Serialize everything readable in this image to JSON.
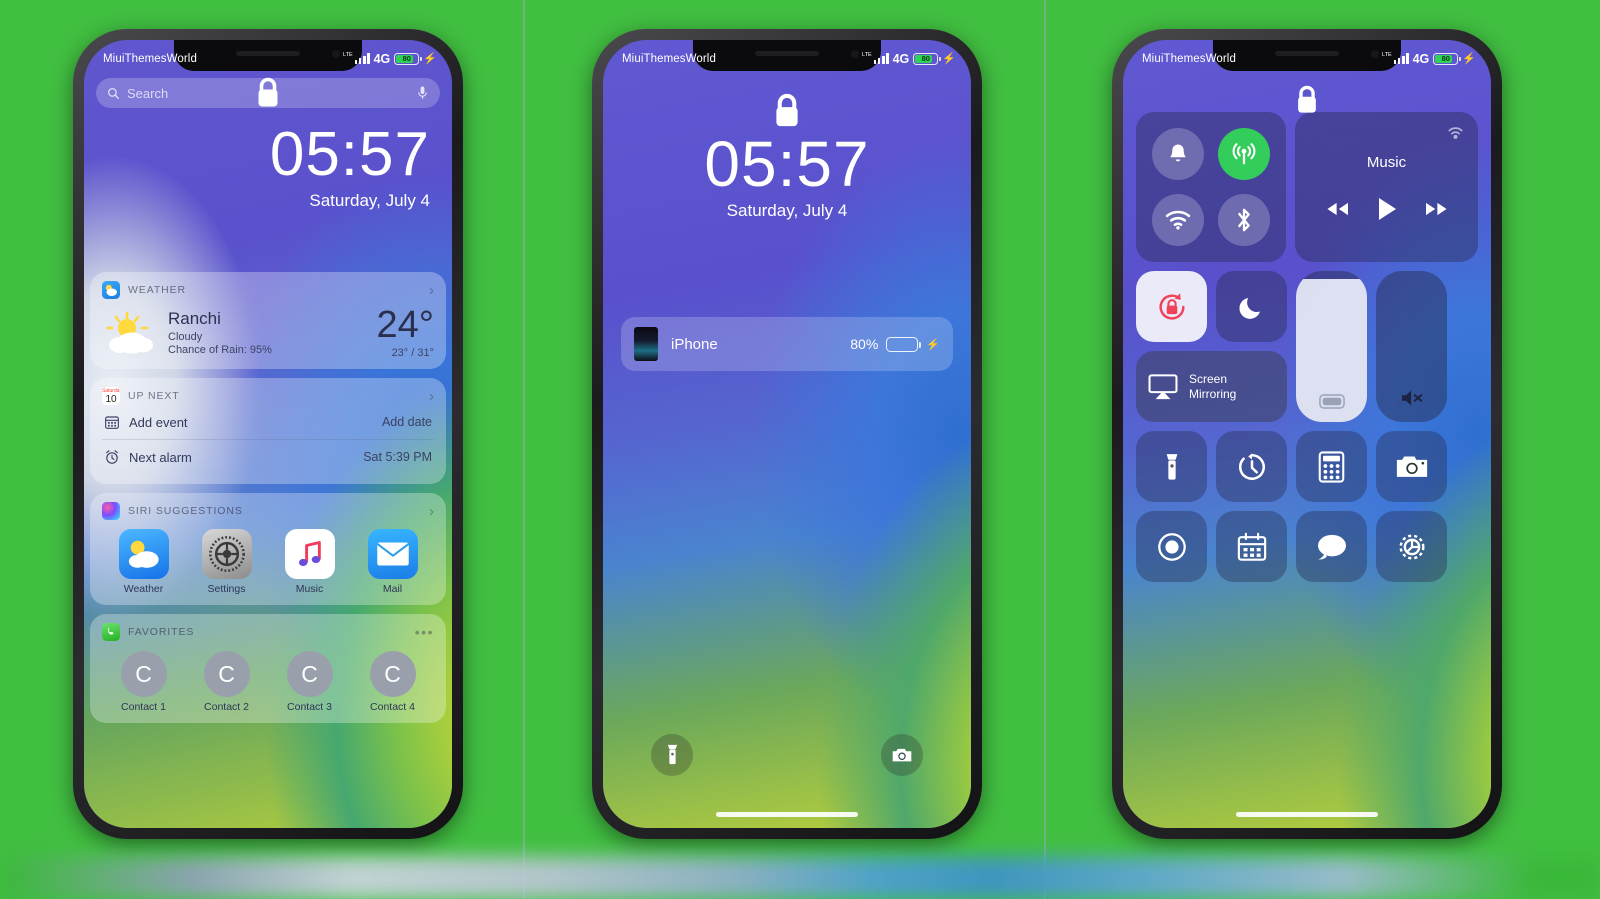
{
  "meta": {
    "background_color": "#41bf41",
    "watermark": "MiuiThemesWorld"
  },
  "status_bar": {
    "carrier_label": "MiuiThemesWorld",
    "network_type": "4G",
    "lte_tag": "LTE",
    "battery_level": "80",
    "battery_percent": 80,
    "charging": true,
    "signal_bars": 4
  },
  "lock_screen": {
    "time": "05:57",
    "date": "Saturday, July 4",
    "lock_icon": "lock-icon",
    "search": {
      "placeholder": "Search",
      "search_icon": "search-icon",
      "mic_icon": "microphone-icon"
    },
    "notification": {
      "app": "iPhone",
      "battery_percent": "80%",
      "charging": true
    },
    "shortcuts": [
      {
        "name": "flashlight",
        "icon": "flashlight-icon"
      },
      {
        "name": "camera",
        "icon": "camera-icon"
      }
    ]
  },
  "widgets": [
    {
      "id": "weather",
      "title": "WEATHER",
      "icon": "weather-app-icon",
      "chevron": "›",
      "city": "Ranchi",
      "condition": "Cloudy",
      "rain": "Chance of Rain: 95%",
      "temperature": "24°",
      "high_low": "23° / 31°",
      "condition_icon": "sun-behind-cloud-icon"
    },
    {
      "id": "up_next",
      "title": "UP NEXT",
      "icon": "calendar-app-icon",
      "icon_day": "10",
      "chevron": "›",
      "rows": [
        {
          "label": "Add event",
          "value": "Add date",
          "icon": "calendar-icon"
        },
        {
          "label": "Next alarm",
          "value": "Sat 5:39 PM",
          "icon": "alarm-clock-icon"
        }
      ]
    },
    {
      "id": "siri_suggestions",
      "title": "SIRI SUGGESTIONS",
      "icon": "siri-icon",
      "chevron": "›",
      "apps": [
        {
          "name": "Weather",
          "icon": "weather-app-icon"
        },
        {
          "name": "Settings",
          "icon": "settings-app-icon"
        },
        {
          "name": "Music",
          "icon": "music-app-icon"
        },
        {
          "name": "Mail",
          "icon": "mail-app-icon"
        }
      ]
    },
    {
      "id": "favorites",
      "title": "FAVORITES",
      "icon": "phone-app-icon",
      "menu": "•••",
      "contacts": [
        {
          "name": "Contact 1",
          "initial": "C"
        },
        {
          "name": "Contact 2",
          "initial": "C"
        },
        {
          "name": "Contact 3",
          "initial": "C"
        },
        {
          "name": "Contact 4",
          "initial": "C"
        }
      ]
    }
  ],
  "control_center": {
    "connectivity": [
      {
        "name": "airplane-mode",
        "icon": "bell-icon",
        "active": false
      },
      {
        "name": "cellular-data",
        "icon": "cellular-icon",
        "active": true
      },
      {
        "name": "wifi",
        "icon": "wifi-icon",
        "active": false
      },
      {
        "name": "bluetooth",
        "icon": "bluetooth-icon",
        "active": false
      }
    ],
    "media": {
      "label": "Music",
      "airplay_icon": "airplay-audio-icon",
      "controls": [
        {
          "name": "previous",
          "icon": "rewind-icon"
        },
        {
          "name": "play",
          "icon": "play-icon"
        },
        {
          "name": "next",
          "icon": "fast-forward-icon"
        }
      ]
    },
    "toggles": [
      {
        "name": "rotation-lock",
        "icon": "rotation-lock-icon",
        "active": true
      },
      {
        "name": "do-not-disturb",
        "icon": "moon-icon",
        "active": false
      }
    ],
    "screen_mirroring": {
      "label": "Screen\nMirroring",
      "line1": "Screen",
      "line2": "Mirroring",
      "icon": "airplay-screen-icon"
    },
    "brightness": {
      "name": "brightness-slider",
      "value": 95,
      "icon": "brightness-icon"
    },
    "volume": {
      "name": "volume-slider",
      "value": 0,
      "icon": "speaker-muted-icon"
    },
    "shortcuts_row1": [
      {
        "name": "flashlight",
        "icon": "flashlight-icon"
      },
      {
        "name": "timer",
        "icon": "timer-icon"
      },
      {
        "name": "calculator",
        "icon": "calculator-icon"
      },
      {
        "name": "camera",
        "icon": "camera-icon"
      }
    ],
    "shortcuts_row2": [
      {
        "name": "screen-record",
        "icon": "screen-record-icon"
      },
      {
        "name": "calendar",
        "icon": "calendar-icon"
      },
      {
        "name": "messages",
        "icon": "message-bubble-icon"
      },
      {
        "name": "settings",
        "icon": "gear-icon"
      }
    ]
  }
}
